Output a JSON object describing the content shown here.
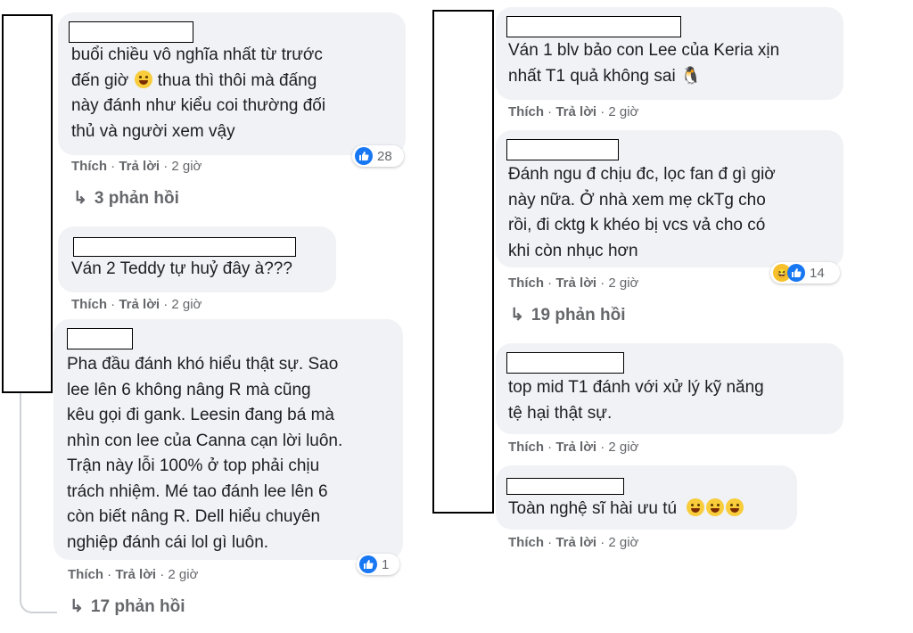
{
  "comments": [
    {
      "lines": [
        "buổi chiều vô nghĩa nhất từ trước",
        "đến giờ 🙂 thua thì thôi mà đấng",
        "này đánh như kiểu coi thường đối",
        "thủ và người xem vậy"
      ],
      "actions": {
        "like": "Thích",
        "reply": "Trả lời",
        "time": "2 giờ"
      },
      "reaction_count": "28",
      "replies": "3 phản hồi"
    },
    {
      "lines": [
        "Ván 2 Teddy tự huỷ đây à???"
      ],
      "actions": {
        "like": "Thích",
        "reply": "Trả lời",
        "time": "2 giờ"
      }
    },
    {
      "lines": [
        "Pha đầu đánh khó hiểu thật sự. Sao",
        "lee lên 6 không nâng R mà cũng",
        "kêu gọi đi gank. Leesin đang bá mà",
        "nhìn con lee của Canna cạn lời luôn.",
        "Trận này lỗi 100% ở top phải chịu",
        "trách nhiệm. Mé tao đánh lee lên 6",
        "còn biết nâng R. Dell hiểu chuyên",
        "nghiệp đánh cái lol gì luôn."
      ],
      "actions": {
        "like": "Thích",
        "reply": "Trả lời",
        "time": "2 giờ"
      },
      "reaction_count": "1",
      "replies": "17 phản hồi"
    },
    {
      "lines": [
        "Ván 1 blv bảo con Lee của Keria xịn",
        "nhất T1 quả không sai 🐧"
      ],
      "actions": {
        "like": "Thích",
        "reply": "Trả lời",
        "time": "2 giờ"
      }
    },
    {
      "lines": [
        "Đánh ngu đ chịu đc, lọc fan đ gì giờ",
        "này nữa. Ở nhà xem mẹ ckTg cho",
        "rồi, đi cktg k khéo bị vcs vả cho có",
        "khi còn nhục hơn"
      ],
      "actions": {
        "like": "Thích",
        "reply": "Trả lời",
        "time": "2 giờ"
      },
      "reaction_count": "14",
      "replies": "19 phản hồi"
    },
    {
      "lines": [
        "top mid T1 đánh với xử lý kỹ năng",
        "tệ hại thật sự."
      ],
      "actions": {
        "like": "Thích",
        "reply": "Trả lời",
        "time": "2 giờ"
      }
    },
    {
      "lines": [
        "Toàn nghệ sĩ hài ưu tú"
      ],
      "actions": {
        "like": "Thích",
        "reply": "Trả lời",
        "time": "2 giờ"
      }
    }
  ],
  "colors": {
    "bubble": "#f0f2f5",
    "meta": "#65676b",
    "like_blue": "#1877f2",
    "text": "#1c1e21"
  }
}
